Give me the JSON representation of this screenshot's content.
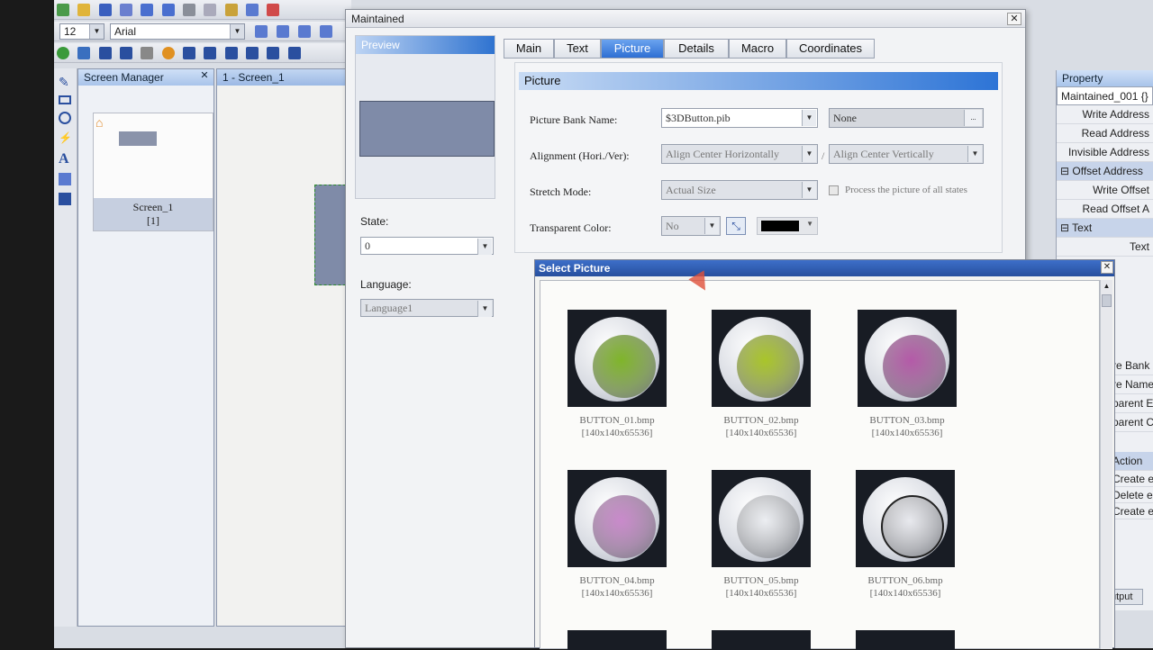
{
  "toolbar": {
    "font_size": "12",
    "font_name": "Arial"
  },
  "screen_manager": {
    "title": "Screen Manager",
    "screen_label": "Screen_1",
    "screen_index": "[1]"
  },
  "screen_tab": {
    "label": "1 - Screen_1"
  },
  "dialog": {
    "title": "Maintained",
    "preview_label": "Preview",
    "state_label": "State:",
    "state_value": "0",
    "language_label": "Language:",
    "language_value": "Language1",
    "tabs": [
      "Main",
      "Text",
      "Picture",
      "Details",
      "Macro",
      "Coordinates"
    ],
    "active_tab": "Picture",
    "picture": {
      "section_title": "Picture",
      "bank_label": "Picture Bank Name:",
      "bank_value": "$3DButton.pib",
      "bank_name_value": "None",
      "browse": "...",
      "alignment_label": "Alignment (Hori./Ver):",
      "align_h": "Align Center Horizontally",
      "slash": "/",
      "align_v": "Align Center Vertically",
      "stretch_label": "Stretch Mode:",
      "stretch_value": "Actual Size",
      "process_label": "Process the picture of all states",
      "transparent_label": "Transparent Color:",
      "transparent_value": "No"
    }
  },
  "select_picture": {
    "title": "Select Picture",
    "items": [
      {
        "name": "BUTTON_01.bmp",
        "size": "[140x140x65536]",
        "color": "#7fb52a"
      },
      {
        "name": "BUTTON_02.bmp",
        "size": "[140x140x65536]",
        "color": "#a9c52a"
      },
      {
        "name": "BUTTON_03.bmp",
        "size": "[140x140x65536]",
        "color": "#b45aa8"
      },
      {
        "name": "BUTTON_04.bmp",
        "size": "[140x140x65536]",
        "color": "#c98acb"
      },
      {
        "name": "BUTTON_05.bmp",
        "size": "[140x140x65536]",
        "color": "#eceef2"
      },
      {
        "name": "BUTTON_06.bmp",
        "size": "[140x140x65536]",
        "color": "#e8e9ee"
      }
    ]
  },
  "property": {
    "title": "Property",
    "object": "Maintained_001 {}",
    "rows": [
      {
        "label": "Write Address",
        "section": false
      },
      {
        "label": "Read Address",
        "section": false
      },
      {
        "label": "Invisible Address",
        "section": false
      },
      {
        "label": "Offset Address",
        "section": true
      },
      {
        "label": "Write Offset",
        "section": false
      },
      {
        "label": "Read Offset A",
        "section": false
      },
      {
        "label": "Text",
        "section": true
      },
      {
        "label": "Text",
        "section": false
      }
    ],
    "right_rows": [
      "re Bank N",
      "re Name",
      "parent E",
      "parent C"
    ],
    "action": {
      "title": "Action",
      "items": [
        "Create e",
        "Delete e",
        "Create e"
      ]
    },
    "output_label": "utput"
  }
}
